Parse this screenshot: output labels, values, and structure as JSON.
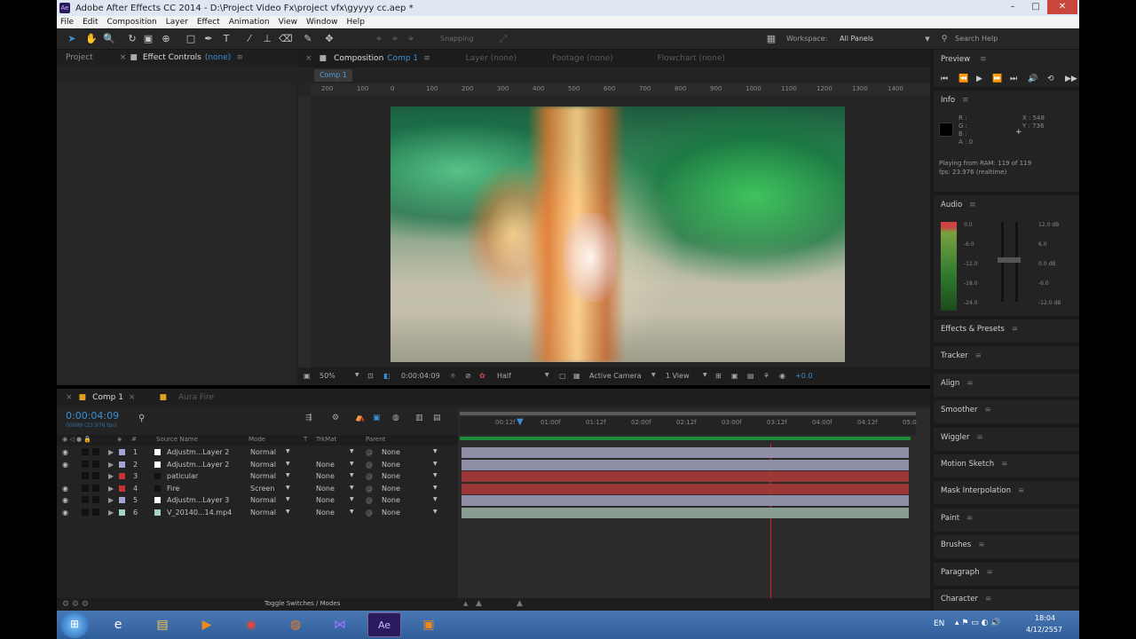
{
  "window": {
    "title": "Adobe After Effects CC 2014 - D:\\Project Video Fx\\project vfx\\gyyyy cc.aep *",
    "icon_text": "Ae"
  },
  "menu": [
    "File",
    "Edit",
    "Composition",
    "Layer",
    "Effect",
    "Animation",
    "View",
    "Window",
    "Help"
  ],
  "toolbar": {
    "snapping": "Snapping",
    "workspace_label": "Workspace:",
    "workspace_value": "All Panels",
    "search_placeholder": "Search Help"
  },
  "left_panel": {
    "tab_project": "Project",
    "tab_effect_controls": "Effect Controls",
    "effect_controls_target": "(none)"
  },
  "comp_panel": {
    "tab_label": "Composition",
    "comp_name": "Comp 1",
    "layer_tab": "Layer (none)",
    "footage_tab": "Footage (none)",
    "flowchart_tab": "Flowchart (none)",
    "comp_chip": "Comp 1",
    "ruler_ticks": [
      "200",
      "100",
      "0",
      "100",
      "200",
      "300",
      "400",
      "500",
      "600",
      "700",
      "800",
      "900",
      "1000",
      "1100",
      "1200",
      "1300",
      "1400"
    ]
  },
  "viewer": {
    "zoom": "50%",
    "timecode": "0:00:04:09",
    "resolution": "Half",
    "camera": "Active Camera",
    "views": "1 View",
    "exposure": "+0.0"
  },
  "timeline": {
    "tabs": [
      "Comp 1",
      "Aura Fire"
    ],
    "current_time": "0:00:04:09",
    "fps_line": "00099 (23.976 fps)",
    "search_icon": "⚲",
    "columns": {
      "source": "Source Name",
      "mode": "Mode",
      "trkmat": "TrkMat",
      "parent": "Parent"
    },
    "ruler_ticks": [
      "00:12f",
      "01:00f",
      "01:12f",
      "02:00f",
      "02:12f",
      "03:00f",
      "03:12f",
      "04:00f",
      "04:12f",
      "05:0"
    ],
    "layers": [
      {
        "num": "1",
        "name": "Adjustm...Layer 2",
        "mode": "Normal",
        "trkmat": "",
        "parent": "None",
        "label": "#a4a4d4",
        "icon": "#ffffff",
        "bar": "#8e8ea6"
      },
      {
        "num": "2",
        "name": "Adjustm...Layer 2",
        "mode": "Normal",
        "trkmat": "None",
        "parent": "None",
        "label": "#a4a4d4",
        "icon": "#ffffff",
        "bar": "#8e8ea6"
      },
      {
        "num": "3",
        "name": "paticular",
        "mode": "Normal",
        "trkmat": "None",
        "parent": "None",
        "label": "#c83232",
        "icon": "#111111",
        "bar": "#9c3737"
      },
      {
        "num": "4",
        "name": "Fire",
        "mode": "Screen",
        "trkmat": "None",
        "parent": "None",
        "label": "#c83232",
        "icon": "#111111",
        "bar": "#9c3737"
      },
      {
        "num": "5",
        "name": "Adjustm...Layer 3",
        "mode": "Normal",
        "trkmat": "None",
        "parent": "None",
        "label": "#a4a4d4",
        "icon": "#ffffff",
        "bar": "#8e8ea6"
      },
      {
        "num": "6",
        "name": "V_20140...14.mp4",
        "mode": "Normal",
        "trkmat": "None",
        "parent": "None",
        "label": "#a6d4bc",
        "icon": "#a6d4bc",
        "bar": "#8a9d92"
      }
    ],
    "toggle": "Toggle Switches / Modes"
  },
  "preview": {
    "title": "Preview"
  },
  "info": {
    "title": "Info",
    "r": "R :",
    "g": "G :",
    "b": "B :",
    "a": "A : 0",
    "x": "X : 548",
    "y": "Y : 736",
    "playing": "Playing from RAM: 119 of 119",
    "fps": "fps: 23.976 (realtime)"
  },
  "audio": {
    "title": "Audio",
    "left_scale": [
      "0.0",
      "-6.0",
      "-12.0",
      "-18.0",
      "-24.0"
    ],
    "right_scale": [
      "12.0 dB",
      "6.0",
      "0.0 dB",
      "-6.0",
      "-12.0 dB"
    ]
  },
  "panels": [
    "Effects & Presets",
    "Tracker",
    "Align",
    "Smoother",
    "Wiggler",
    "Motion Sketch",
    "Mask Interpolation",
    "Paint",
    "Brushes",
    "Paragraph",
    "Character"
  ],
  "taskbar": {
    "lang": "EN",
    "time": "18:04",
    "date": "4/12/2557",
    "ae_label": "Ae"
  }
}
